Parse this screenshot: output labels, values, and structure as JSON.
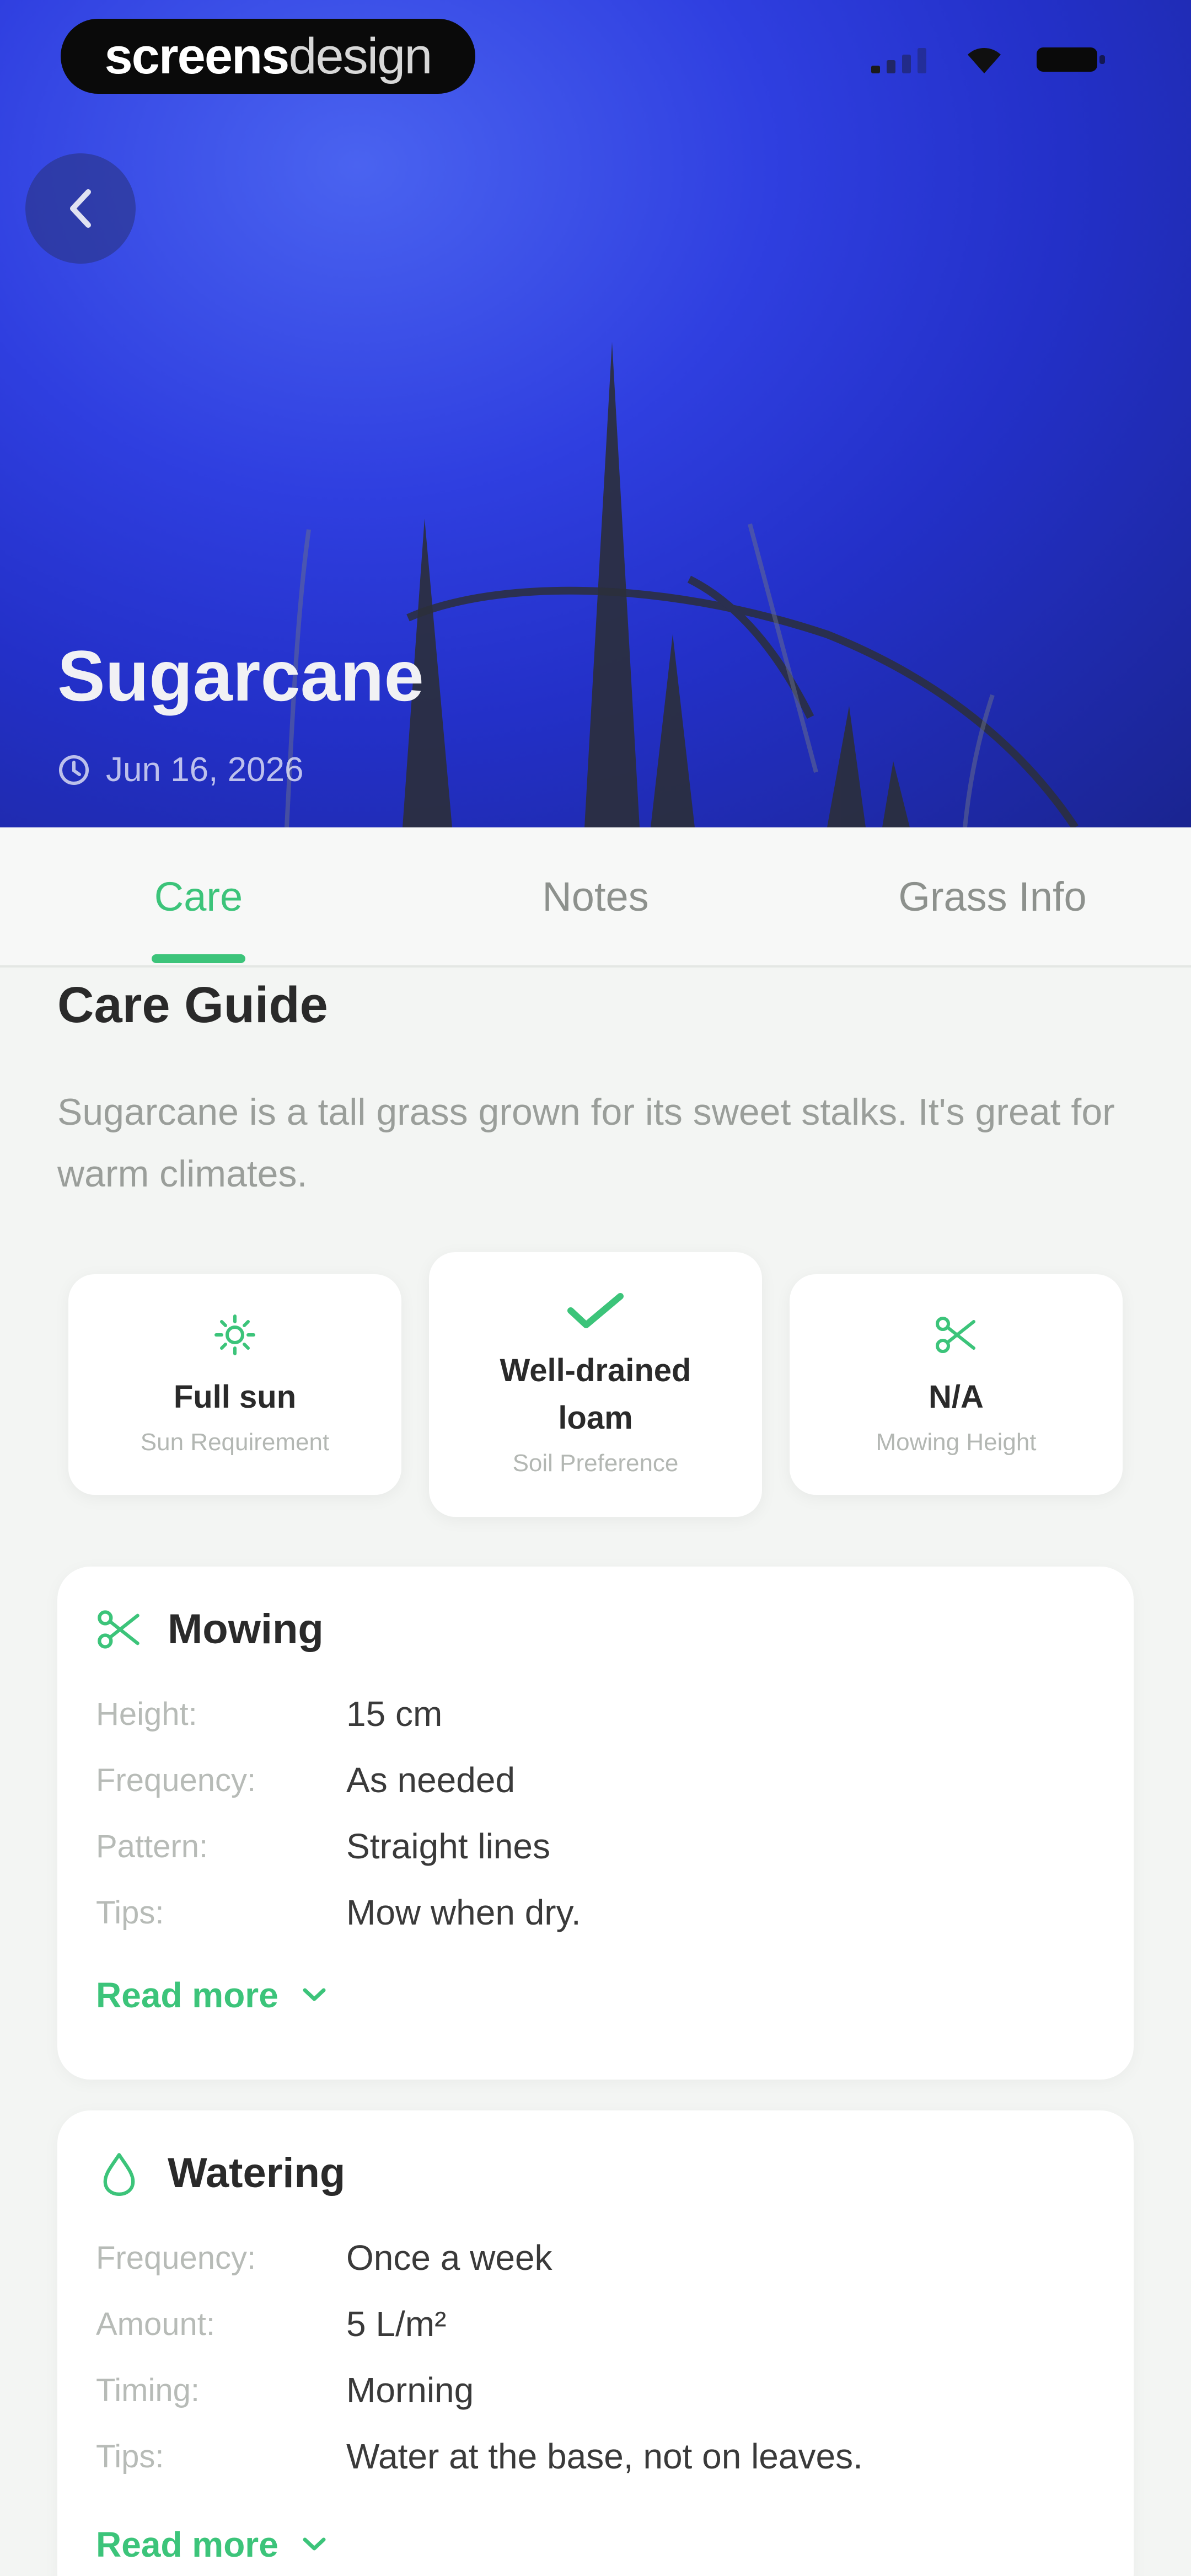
{
  "app": {
    "brand_bold": "screens",
    "brand_light": "design"
  },
  "hero": {
    "title": "Sugarcane",
    "date": "Jun 16, 2026"
  },
  "tabs": [
    {
      "label": "Care",
      "active": true
    },
    {
      "label": "Notes",
      "active": false
    },
    {
      "label": "Grass Info",
      "active": false
    }
  ],
  "care_guide": {
    "title": "Care Guide",
    "description": "Sugarcane is a tall grass grown for its sweet stalks. It's great for warm climates.",
    "stats": [
      {
        "icon": "sun-icon",
        "value": "Full sun",
        "label": "Sun Requirement"
      },
      {
        "icon": "check-icon",
        "value": "Well-drained loam",
        "label": "Soil Preference"
      },
      {
        "icon": "scissors-icon",
        "value": "N/A",
        "label": "Mowing Height"
      }
    ]
  },
  "mowing": {
    "title": "Mowing",
    "icon": "scissors-icon",
    "rows": [
      {
        "key": "Height:",
        "value": "15 cm"
      },
      {
        "key": "Frequency:",
        "value": "As needed"
      },
      {
        "key": "Pattern:",
        "value": "Straight lines"
      },
      {
        "key": "Tips:",
        "value": "Mow when dry."
      }
    ],
    "read_more": "Read more"
  },
  "watering": {
    "title": "Watering",
    "icon": "water-drop-icon",
    "rows": [
      {
        "key": "Frequency:",
        "value": "Once a week"
      },
      {
        "key": "Amount:",
        "value": "5 L/m²"
      },
      {
        "key": "Timing:",
        "value": "Morning"
      },
      {
        "key": "Tips:",
        "value": "Water at the base, not on leaves."
      }
    ],
    "read_more": "Read more"
  },
  "colors": {
    "accent": "#3cc47a",
    "hero_blue": "#2f3fe0"
  }
}
